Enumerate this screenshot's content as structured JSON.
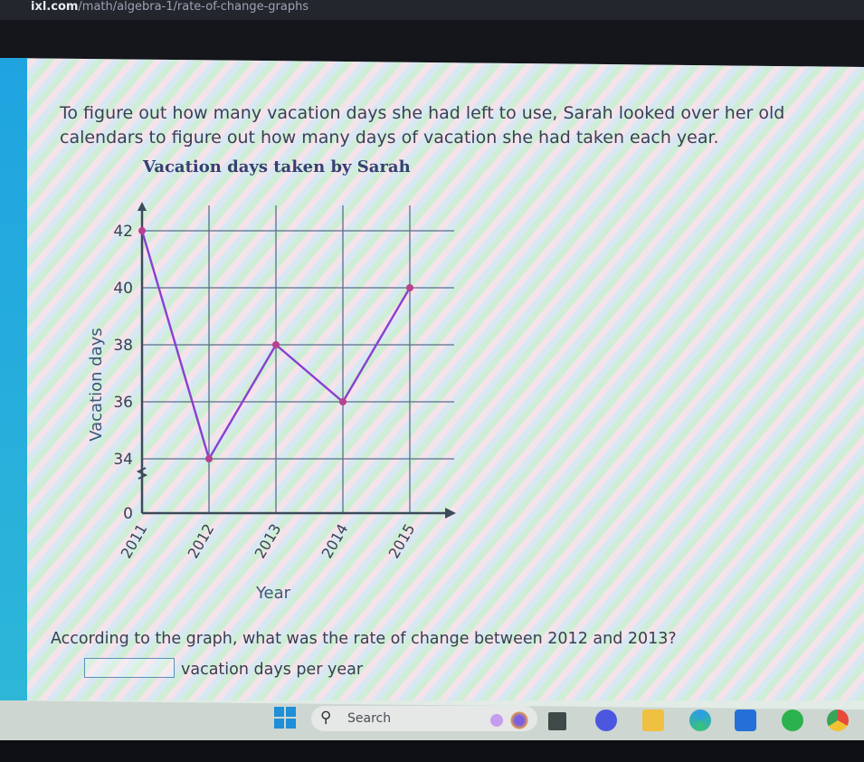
{
  "browser": {
    "url_host": "ixl.com",
    "url_path": "/math/algebra-1/rate-of-change-graphs"
  },
  "problem": {
    "intro": "To figure out how many vacation days she had left to use, Sarah looked over her old calendars to figure out how many days of vacation she had taken each year.",
    "question": "According to the graph, what was the rate of change between 2012 and 2013?",
    "answer_value": "",
    "answer_unit": "vacation days per year"
  },
  "chart_data": {
    "type": "line",
    "title": "Vacation days taken by Sarah",
    "xlabel": "Year",
    "ylabel": "Vacation days",
    "categories": [
      "2011",
      "2012",
      "2013",
      "2014",
      "2015"
    ],
    "series": [
      {
        "name": "Vacation days",
        "values": [
          42,
          34,
          38,
          36,
          40
        ]
      }
    ],
    "y_ticks": [
      0,
      34,
      36,
      38,
      40,
      42
    ],
    "ylim": [
      34,
      42
    ],
    "y_axis_break": true,
    "grid": true,
    "colors": {
      "line": "#8a3fd0",
      "point": "#b8408f",
      "axis": "#3c4a5a",
      "grid": "#5a6e8c"
    }
  },
  "taskbar": {
    "search_label": "Search",
    "apps": [
      "widgets",
      "snap-app",
      "meet",
      "file-explorer",
      "edge",
      "store",
      "spotify",
      "chrome"
    ]
  }
}
